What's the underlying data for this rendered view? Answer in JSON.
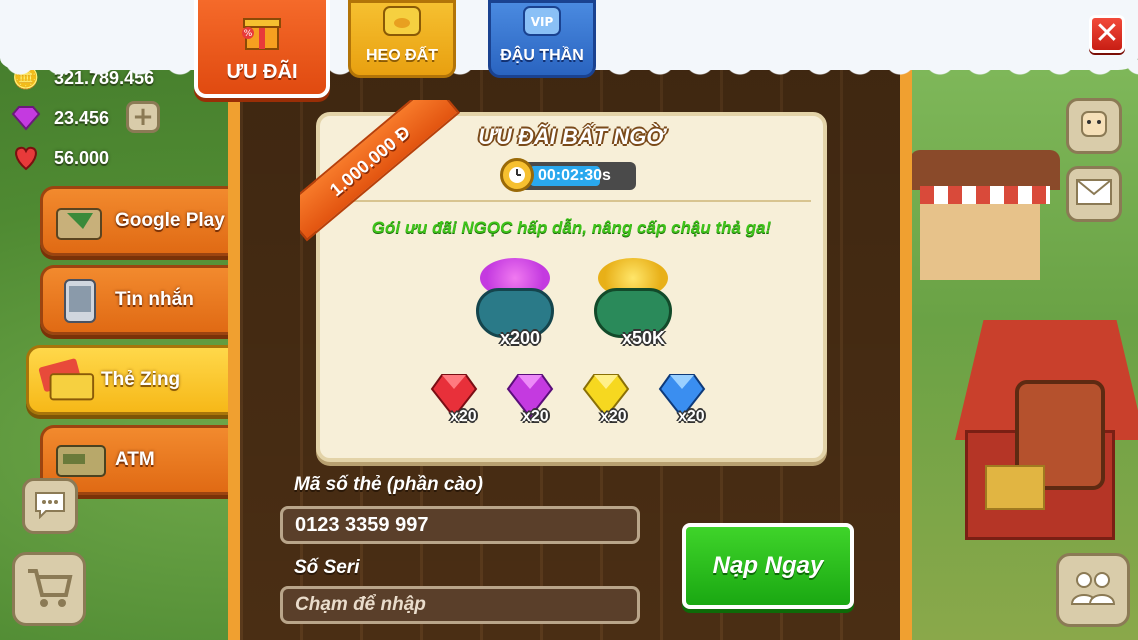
{
  "currency": {
    "gold": "321.789.456",
    "gems": "23.456",
    "hearts": "56.000"
  },
  "side_tabs": [
    {
      "label": "Google Play",
      "icon": "google-play-card-icon",
      "active": false
    },
    {
      "label": "Tin nhắn",
      "icon": "sms-phone-icon",
      "active": false
    },
    {
      "label": "Thẻ Zing",
      "icon": "zing-card-icon",
      "active": true
    },
    {
      "label": "ATM",
      "icon": "atm-card-icon",
      "active": false
    }
  ],
  "top_tabs": [
    {
      "label": "ƯU ĐÃI",
      "icon": "gift-percent-icon",
      "active": true
    },
    {
      "label": "HEO ĐẤT",
      "icon": "piggy-bank-icon",
      "active": false
    },
    {
      "label": "ĐẬU THẦN",
      "icon": "vip-bean-icon",
      "active": false
    }
  ],
  "offer": {
    "title": "ƯU ĐÃI BẤT NGỜ",
    "ribbon_price": "1.000.000 Đ",
    "timer": "00:02:30s",
    "description": "Gói ưu đãi NGỌC hấp dẫn, nâng cấp chậu thả ga!",
    "pots": [
      {
        "name": "gem-pot",
        "qty": "x200"
      },
      {
        "name": "gold-pot",
        "qty": "x50K"
      }
    ],
    "gems": [
      {
        "name": "red-gem",
        "qty": "x20",
        "color": "#e8303a"
      },
      {
        "name": "purple-gem",
        "qty": "x20",
        "color": "#c43ae0"
      },
      {
        "name": "yellow-gem",
        "qty": "x20",
        "color": "#f6d820"
      },
      {
        "name": "blue-gem",
        "qty": "x20",
        "color": "#3a8ef0"
      }
    ]
  },
  "form": {
    "card_label": "Mã số thẻ (phần cào)",
    "card_value": "0123 3359 997",
    "serial_label": "Số Seri",
    "serial_placeholder": "Chạm để nhập",
    "submit_label": "Nạp Ngay"
  },
  "colors": {
    "accent_orange": "#f28a2e",
    "active_yellow": "#f6b818",
    "cta_green": "#1aa812"
  }
}
